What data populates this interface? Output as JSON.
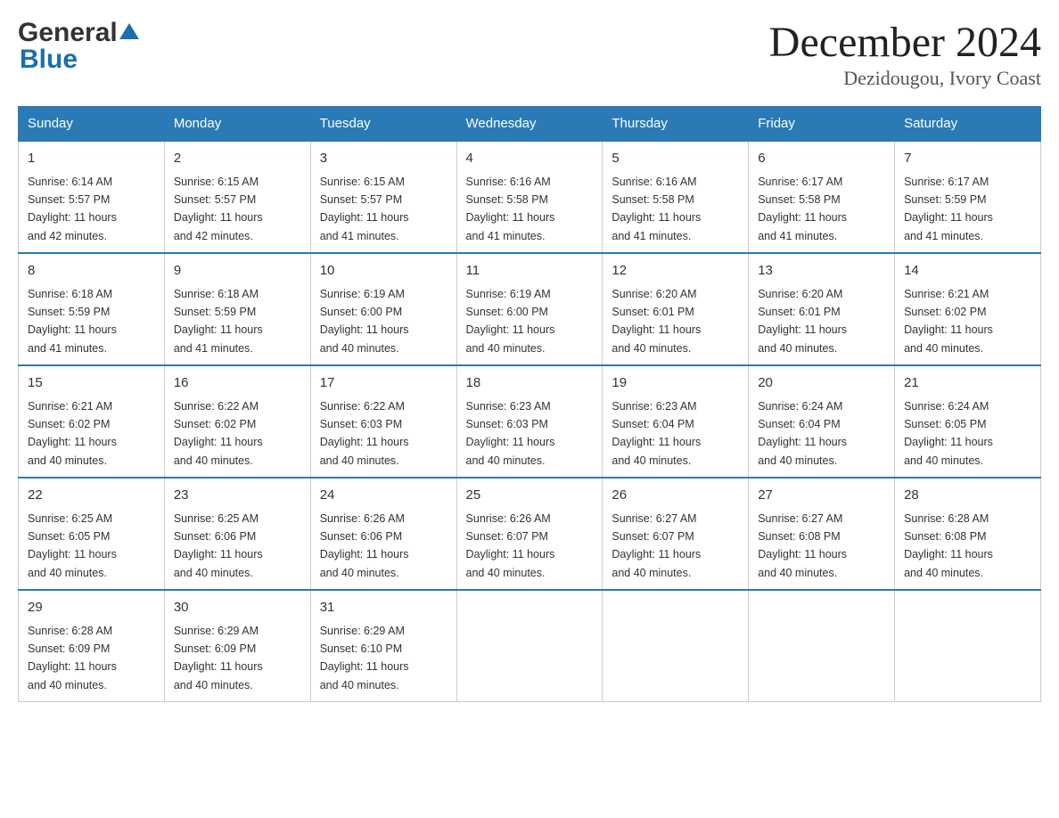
{
  "header": {
    "logo_general": "General",
    "logo_blue": "Blue",
    "month_title": "December 2024",
    "location": "Dezidougou, Ivory Coast"
  },
  "days_of_week": [
    "Sunday",
    "Monday",
    "Tuesday",
    "Wednesday",
    "Thursday",
    "Friday",
    "Saturday"
  ],
  "weeks": [
    [
      {
        "day": "1",
        "sunrise": "6:14 AM",
        "sunset": "5:57 PM",
        "daylight": "11 hours and 42 minutes."
      },
      {
        "day": "2",
        "sunrise": "6:15 AM",
        "sunset": "5:57 PM",
        "daylight": "11 hours and 42 minutes."
      },
      {
        "day": "3",
        "sunrise": "6:15 AM",
        "sunset": "5:57 PM",
        "daylight": "11 hours and 41 minutes."
      },
      {
        "day": "4",
        "sunrise": "6:16 AM",
        "sunset": "5:58 PM",
        "daylight": "11 hours and 41 minutes."
      },
      {
        "day": "5",
        "sunrise": "6:16 AM",
        "sunset": "5:58 PM",
        "daylight": "11 hours and 41 minutes."
      },
      {
        "day": "6",
        "sunrise": "6:17 AM",
        "sunset": "5:58 PM",
        "daylight": "11 hours and 41 minutes."
      },
      {
        "day": "7",
        "sunrise": "6:17 AM",
        "sunset": "5:59 PM",
        "daylight": "11 hours and 41 minutes."
      }
    ],
    [
      {
        "day": "8",
        "sunrise": "6:18 AM",
        "sunset": "5:59 PM",
        "daylight": "11 hours and 41 minutes."
      },
      {
        "day": "9",
        "sunrise": "6:18 AM",
        "sunset": "5:59 PM",
        "daylight": "11 hours and 41 minutes."
      },
      {
        "day": "10",
        "sunrise": "6:19 AM",
        "sunset": "6:00 PM",
        "daylight": "11 hours and 40 minutes."
      },
      {
        "day": "11",
        "sunrise": "6:19 AM",
        "sunset": "6:00 PM",
        "daylight": "11 hours and 40 minutes."
      },
      {
        "day": "12",
        "sunrise": "6:20 AM",
        "sunset": "6:01 PM",
        "daylight": "11 hours and 40 minutes."
      },
      {
        "day": "13",
        "sunrise": "6:20 AM",
        "sunset": "6:01 PM",
        "daylight": "11 hours and 40 minutes."
      },
      {
        "day": "14",
        "sunrise": "6:21 AM",
        "sunset": "6:02 PM",
        "daylight": "11 hours and 40 minutes."
      }
    ],
    [
      {
        "day": "15",
        "sunrise": "6:21 AM",
        "sunset": "6:02 PM",
        "daylight": "11 hours and 40 minutes."
      },
      {
        "day": "16",
        "sunrise": "6:22 AM",
        "sunset": "6:02 PM",
        "daylight": "11 hours and 40 minutes."
      },
      {
        "day": "17",
        "sunrise": "6:22 AM",
        "sunset": "6:03 PM",
        "daylight": "11 hours and 40 minutes."
      },
      {
        "day": "18",
        "sunrise": "6:23 AM",
        "sunset": "6:03 PM",
        "daylight": "11 hours and 40 minutes."
      },
      {
        "day": "19",
        "sunrise": "6:23 AM",
        "sunset": "6:04 PM",
        "daylight": "11 hours and 40 minutes."
      },
      {
        "day": "20",
        "sunrise": "6:24 AM",
        "sunset": "6:04 PM",
        "daylight": "11 hours and 40 minutes."
      },
      {
        "day": "21",
        "sunrise": "6:24 AM",
        "sunset": "6:05 PM",
        "daylight": "11 hours and 40 minutes."
      }
    ],
    [
      {
        "day": "22",
        "sunrise": "6:25 AM",
        "sunset": "6:05 PM",
        "daylight": "11 hours and 40 minutes."
      },
      {
        "day": "23",
        "sunrise": "6:25 AM",
        "sunset": "6:06 PM",
        "daylight": "11 hours and 40 minutes."
      },
      {
        "day": "24",
        "sunrise": "6:26 AM",
        "sunset": "6:06 PM",
        "daylight": "11 hours and 40 minutes."
      },
      {
        "day": "25",
        "sunrise": "6:26 AM",
        "sunset": "6:07 PM",
        "daylight": "11 hours and 40 minutes."
      },
      {
        "day": "26",
        "sunrise": "6:27 AM",
        "sunset": "6:07 PM",
        "daylight": "11 hours and 40 minutes."
      },
      {
        "day": "27",
        "sunrise": "6:27 AM",
        "sunset": "6:08 PM",
        "daylight": "11 hours and 40 minutes."
      },
      {
        "day": "28",
        "sunrise": "6:28 AM",
        "sunset": "6:08 PM",
        "daylight": "11 hours and 40 minutes."
      }
    ],
    [
      {
        "day": "29",
        "sunrise": "6:28 AM",
        "sunset": "6:09 PM",
        "daylight": "11 hours and 40 minutes."
      },
      {
        "day": "30",
        "sunrise": "6:29 AM",
        "sunset": "6:09 PM",
        "daylight": "11 hours and 40 minutes."
      },
      {
        "day": "31",
        "sunrise": "6:29 AM",
        "sunset": "6:10 PM",
        "daylight": "11 hours and 40 minutes."
      },
      null,
      null,
      null,
      null
    ]
  ],
  "labels": {
    "sunrise": "Sunrise:",
    "sunset": "Sunset:",
    "daylight": "Daylight:"
  }
}
